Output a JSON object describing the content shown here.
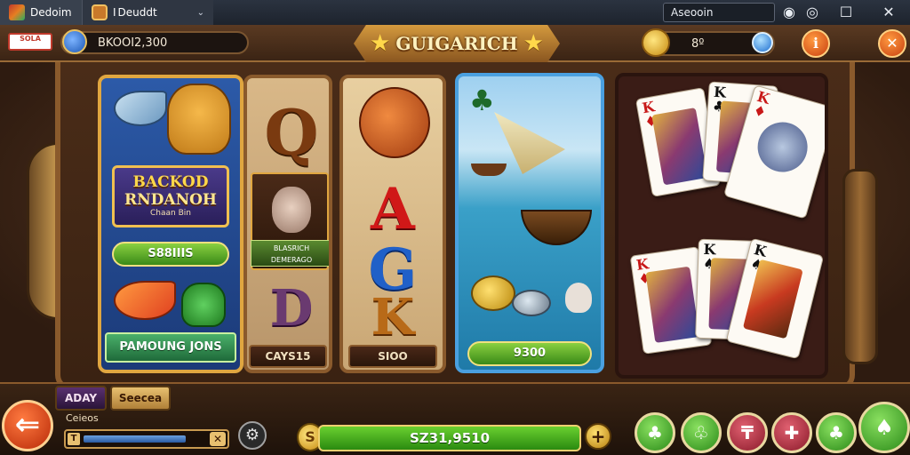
{
  "window": {
    "tab1_title": "Dedoim",
    "tab2_title": "Deuddt",
    "tab2_prefix": "I",
    "search_value": "Aseooin"
  },
  "hud": {
    "flag_badge_text": "SOLA",
    "balance": "BKOOI2,300",
    "title": "GUIGARICH",
    "coin_value": "8º",
    "colors": {
      "accent": "#e0a640",
      "win_green": "#4ab030",
      "board_brown": "#4a2c18"
    }
  },
  "reels": {
    "reel1": {
      "title_line1": "BACKOD",
      "title_line2": "RNDANOH",
      "title_sub": "Chaan Bin",
      "button_label": "S88IIIS",
      "banner_label": "PAMOUNG JONS"
    },
    "reel2": {
      "letter_top": "Q",
      "portrait_label_line1": "BLASRICH",
      "portrait_label_line2": "DEMERAGO",
      "letter_bottom": "D",
      "plate_label": "CAYS15"
    },
    "reel3": {
      "letter_a": "A",
      "letter_g": "G",
      "letter_k": "K",
      "plate_label": "SIOO"
    },
    "reel4": {
      "button_label": "9300"
    },
    "reel5": {
      "cards_top": [
        {
          "rank": "K",
          "suit": "♦",
          "color": "red"
        },
        {
          "rank": "K",
          "suit": "♣",
          "color": "black"
        },
        {
          "rank": "K",
          "suit": "♦",
          "color": "red"
        }
      ],
      "cards_bottom": [
        {
          "rank": "K",
          "suit": "♦",
          "color": "red"
        },
        {
          "rank": "K",
          "suit": "♠",
          "color": "black"
        },
        {
          "rank": "K",
          "suit": "♠",
          "color": "black"
        }
      ]
    }
  },
  "bottom": {
    "tab_left": "ADAY",
    "tab_right": "Seecea",
    "slider_label": "Ceieos",
    "slider_value": 0.82,
    "win_amount": "SZ31,9510",
    "coin_symbol": "S",
    "actions": [
      {
        "name": "bonus-action",
        "icon": "tree-icon",
        "glyph": "♣",
        "color": "green"
      },
      {
        "name": "spin-action",
        "icon": "clover-icon",
        "glyph": "♧",
        "color": "green"
      },
      {
        "name": "bet-action",
        "icon": "t-icon",
        "glyph": "₸",
        "color": "red"
      },
      {
        "name": "gift-action",
        "icon": "gift-icon",
        "glyph": "✚",
        "color": "red"
      },
      {
        "name": "auto-action",
        "icon": "leaf-icon",
        "glyph": "♣",
        "color": "green"
      },
      {
        "name": "play-action",
        "icon": "tree-icon",
        "glyph": "♠",
        "color": "green"
      }
    ]
  }
}
